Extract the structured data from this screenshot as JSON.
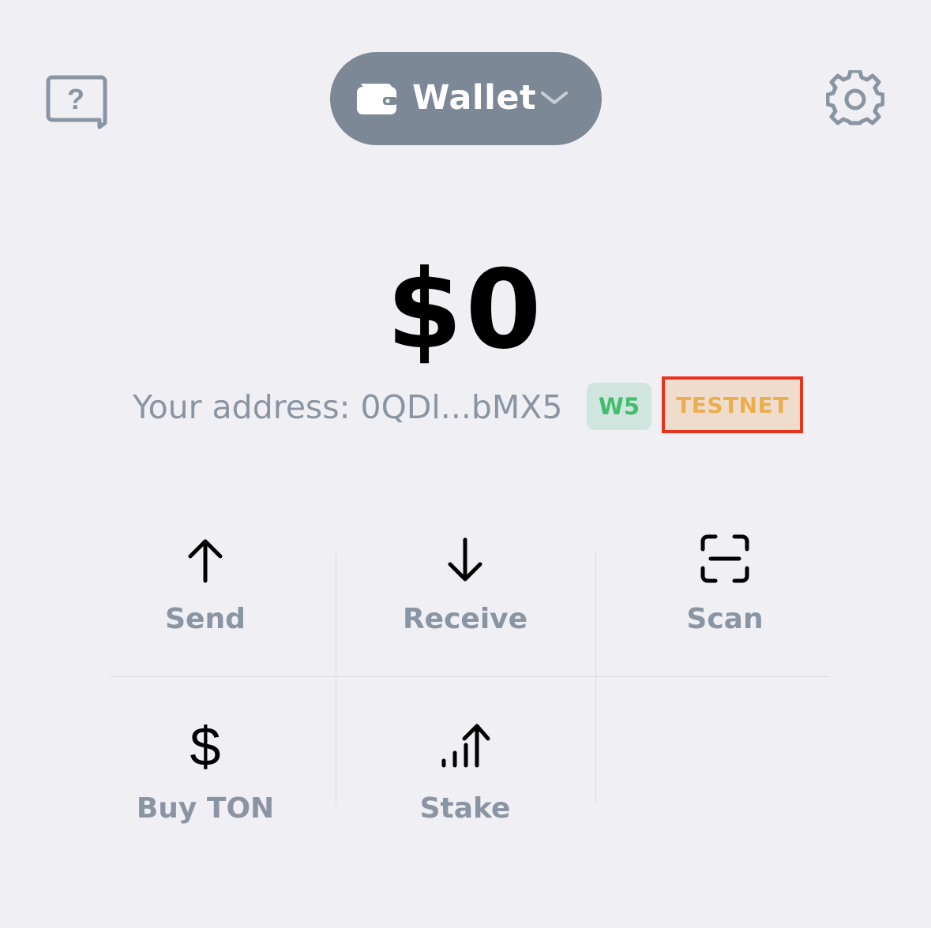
{
  "header": {
    "wallet_label": "Wallet",
    "help_icon": "help-chat-icon",
    "settings_icon": "gear-icon",
    "wallet_icon": "wallet-icon",
    "chevron_icon": "chevron-down-icon"
  },
  "balance": {
    "amount": "$0"
  },
  "address": {
    "text": "Your address: 0QDl...bMX5",
    "version_badge": "W5",
    "network_badge": "TESTNET"
  },
  "actions": [
    {
      "label": "Send",
      "icon": "arrow-up-icon"
    },
    {
      "label": "Receive",
      "icon": "arrow-down-icon"
    },
    {
      "label": "Scan",
      "icon": "scan-icon"
    },
    {
      "label": "Buy TON",
      "icon": "dollar-icon"
    },
    {
      "label": "Stake",
      "icon": "stake-icon"
    }
  ],
  "colors": {
    "background": "#efeff4",
    "pill": "#7d8896",
    "muted_text": "#8a95a3",
    "w5_badge_bg": "#cfe5dd",
    "w5_badge_text": "#3fbe6e",
    "testnet_badge_bg": "#f0dccc",
    "testnet_badge_text": "#ebae4c",
    "highlight_border": "#e8341c"
  }
}
